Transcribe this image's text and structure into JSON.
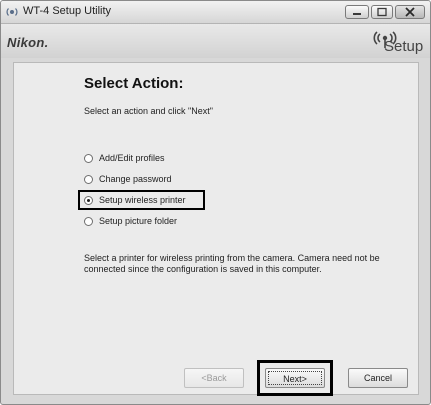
{
  "window": {
    "title": "WT-4 Setup Utility",
    "app_icon": "wireless-app-icon",
    "controls": [
      "minimize-icon",
      "maximize-icon",
      "close-icon"
    ]
  },
  "brand": {
    "logo": "Nikon.",
    "setup_label": "Setup",
    "setup_icon": "antenna-signal-icon"
  },
  "main": {
    "heading": "Select Action:",
    "instruction": "Select an action and click \"Next\"",
    "options": [
      {
        "label": "Add/Edit profiles",
        "selected": false
      },
      {
        "label": "Change password",
        "selected": false
      },
      {
        "label": "Setup wireless printer",
        "selected": true
      },
      {
        "label": "Setup picture folder",
        "selected": false
      }
    ],
    "description": "Select a printer for wireless printing from the camera. Camera need not be connected since the configuration is saved in this computer."
  },
  "buttons": {
    "back": "<Back",
    "next": "Next>",
    "cancel": "Cancel"
  },
  "colors": {
    "window_bg": "#d8d8d8",
    "content_bg": "#ebebeb",
    "focus_outline": "#000000"
  }
}
